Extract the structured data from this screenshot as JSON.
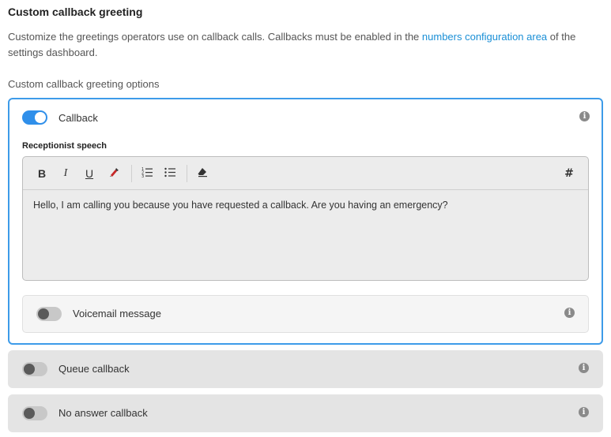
{
  "header": {
    "title": "Custom callback greeting",
    "description_before": "Customize the greetings operators use on callback calls. Callbacks must be enabled in the ",
    "description_link": "numbers configuration area",
    "description_after": " of the settings dashboard.",
    "options_label": "Custom callback greeting options"
  },
  "callback": {
    "label": "Callback",
    "enabled": true,
    "speech_label": "Receptionist speech",
    "speech_text": "Hello, I am calling you because you have requested a callback. Are you having an emergency?",
    "toolbar": {
      "bold": "B",
      "italic": "I",
      "underline": "U",
      "hashtag": "#"
    },
    "voicemail": {
      "label": "Voicemail message",
      "enabled": false
    }
  },
  "queue_callback": {
    "label": "Queue callback",
    "enabled": false
  },
  "no_answer_callback": {
    "label": "No answer callback",
    "enabled": false
  },
  "colors": {
    "accent": "#2f8fea",
    "link": "#1a8fd6",
    "active_border": "#3d9be9"
  },
  "icons": [
    "info-icon",
    "bold-icon",
    "italic-icon",
    "underline-icon",
    "highlight-icon",
    "ordered-list-icon",
    "bullet-list-icon",
    "eraser-icon",
    "hashtag-icon"
  ]
}
